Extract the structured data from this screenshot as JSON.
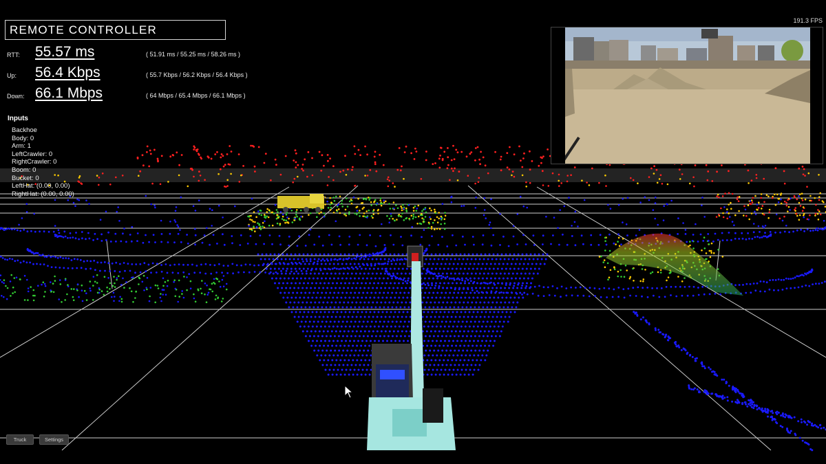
{
  "app": {
    "title": "REMOTE CONTROLLER",
    "fps": "191.3 FPS"
  },
  "metrics": [
    {
      "label": "RTT:",
      "value": "55.57 ms",
      "stats": "( 51.91 ms / 55.25 ms / 58.26 ms )"
    },
    {
      "label": "Up:",
      "value": "56.4 Kbps",
      "stats": "( 55.7 Kbps / 56.2 Kbps / 56.4 Kbps )"
    },
    {
      "label": "Down:",
      "value": "66.1 Mbps",
      "stats": "( 64 Mbps / 65.4 Mbps / 66.1 Mbps )"
    }
  ],
  "inputs": {
    "title": "Inputs",
    "items": [
      "Backhoe",
      "Body: 0",
      "Arm: 1",
      "LeftCrawler: 0",
      "RightCrawler: 0",
      "Boom: 0",
      "Bucket: 0",
      "LeftHat: (0.00, 0.00)",
      "RightHat: (0.00, 0.00)"
    ]
  },
  "buttons": {
    "truck": "Truck",
    "settings": "Settings"
  },
  "colors": {
    "near": "#1a1aff",
    "mid": "#33cc33",
    "high": "#ffcc00",
    "far": "#ff2020",
    "machine": "#a6e6e0"
  }
}
